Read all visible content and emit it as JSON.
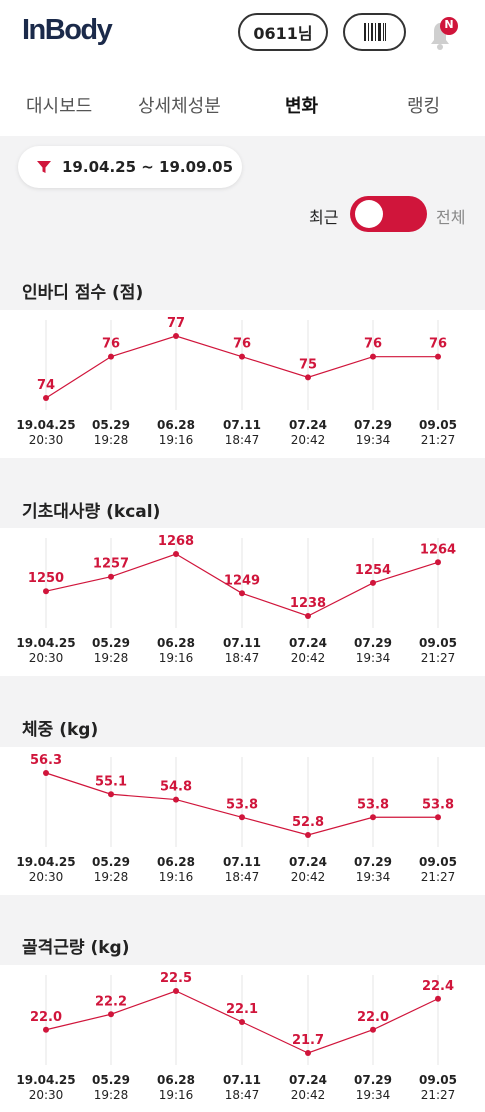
{
  "header": {
    "logo": "InBody",
    "user_label": "0611님",
    "barcode_icon": "barcode-icon",
    "bell_icon": "bell-icon",
    "notification_badge": "N"
  },
  "tabs": [
    {
      "label": "대시보드",
      "active": false
    },
    {
      "label": "상세체성분",
      "active": false
    },
    {
      "label": "변화",
      "active": true
    },
    {
      "label": "랭킹",
      "active": false
    }
  ],
  "filter": {
    "icon": "funnel-icon",
    "date_range": "19.04.25 ~ 19.09.05"
  },
  "toggle": {
    "left_label": "최근",
    "right_label": "전체",
    "selected": "최근"
  },
  "colors": {
    "accent": "#d0153b",
    "grid": "#e6e6e6"
  },
  "dates": [
    {
      "date": "19.04.25",
      "time": "20:30"
    },
    {
      "date": "05.29",
      "time": "19:28"
    },
    {
      "date": "06.28",
      "time": "19:16"
    },
    {
      "date": "07.11",
      "time": "18:47"
    },
    {
      "date": "07.24",
      "time": "20:42"
    },
    {
      "date": "07.29",
      "time": "19:34"
    },
    {
      "date": "09.05",
      "time": "21:27"
    }
  ],
  "chart_data": [
    {
      "type": "line",
      "title": "인바디 점수 (점)",
      "x": [
        "19.04.25 20:30",
        "05.29 19:28",
        "06.28 19:16",
        "07.11 18:47",
        "07.24 20:42",
        "07.29 19:34",
        "09.05 21:27"
      ],
      "values": [
        74,
        76,
        77,
        76,
        75,
        76,
        76
      ],
      "labels": [
        "74",
        "76",
        "77",
        "76",
        "75",
        "76",
        "76"
      ],
      "grid": true
    },
    {
      "type": "line",
      "title": "기초대사량 (kcal)",
      "x": [
        "19.04.25 20:30",
        "05.29 19:28",
        "06.28 19:16",
        "07.11 18:47",
        "07.24 20:42",
        "07.29 19:34",
        "09.05 21:27"
      ],
      "values": [
        1250,
        1257,
        1268,
        1249,
        1238,
        1254,
        1264
      ],
      "labels": [
        "1250",
        "1257",
        "1268",
        "1249",
        "1238",
        "1254",
        "1264"
      ],
      "grid": true
    },
    {
      "type": "line",
      "title": "체중 (kg)",
      "x": [
        "19.04.25 20:30",
        "05.29 19:28",
        "06.28 19:16",
        "07.11 18:47",
        "07.24 20:42",
        "07.29 19:34",
        "09.05 21:27"
      ],
      "values": [
        56.3,
        55.1,
        54.8,
        53.8,
        52.8,
        53.8,
        53.8
      ],
      "labels": [
        "56.3",
        "55.1",
        "54.8",
        "53.8",
        "52.8",
        "53.8",
        "53.8"
      ],
      "grid": true
    },
    {
      "type": "line",
      "title": "골격근량 (kg)",
      "x": [
        "19.04.25 20:30",
        "05.29 19:28",
        "06.28 19:16",
        "07.11 18:47",
        "07.24 20:42",
        "07.29 19:34",
        "09.05 21:27"
      ],
      "values": [
        22.0,
        22.2,
        22.5,
        22.1,
        21.7,
        22.0,
        22.4
      ],
      "labels": [
        "22.0",
        "22.2",
        "22.5",
        "22.1",
        "21.7",
        "22.0",
        "22.4"
      ],
      "grid": true
    }
  ]
}
